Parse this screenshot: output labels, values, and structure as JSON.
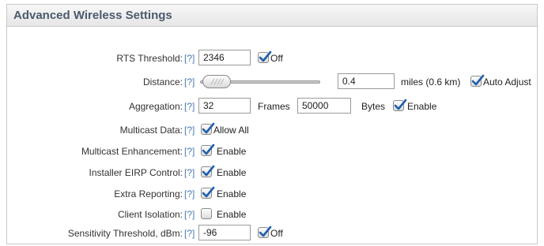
{
  "panel": {
    "title": "Advanced Wireless Settings"
  },
  "help_text": "[?]",
  "rows": {
    "rts": {
      "label": "RTS Threshold:",
      "value": "2346",
      "checkbox_label": "Off",
      "checked": true
    },
    "distance": {
      "label": "Distance:",
      "value": "0.4",
      "unit_text": "miles (0.6 km)",
      "checkbox_label": "Auto Adjust",
      "checked": true,
      "slider_level": 0.03
    },
    "aggregation": {
      "label": "Aggregation:",
      "frames_value": "32",
      "frames_label": "Frames",
      "bytes_value": "50000",
      "bytes_label": "Bytes",
      "checkbox_label": "Enable",
      "checked": true
    },
    "multicast_data": {
      "label": "Multicast Data:",
      "checkbox_label": "Allow All",
      "checked": true
    },
    "multicast_enh": {
      "label": "Multicast Enhancement:",
      "checkbox_label": "Enable",
      "checked": true
    },
    "eirp": {
      "label": "Installer EIRP Control:",
      "checkbox_label": "Enable",
      "checked": true
    },
    "extra": {
      "label": "Extra Reporting:",
      "checkbox_label": "Enable",
      "checked": true
    },
    "isolation": {
      "label": "Client Isolation:",
      "checkbox_label": "Enable",
      "checked": false
    },
    "sensitivity": {
      "label": "Sensitivity Threshold, dBm:",
      "value": "-96",
      "checkbox_label": "Off",
      "checked": true
    }
  }
}
